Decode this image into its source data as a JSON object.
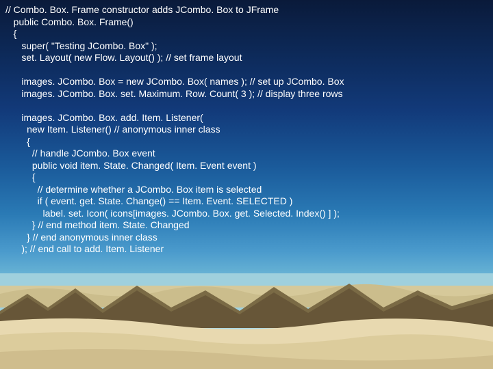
{
  "code": {
    "l01": "// Combo. Box. Frame constructor adds JCombo. Box to JFrame",
    "l02": "   public Combo. Box. Frame()",
    "l03": "   {",
    "l04": "      super( \"Testing JCombo. Box\" );",
    "l05": "      set. Layout( new Flow. Layout() ); // set frame layout",
    "l06": "",
    "l07": "      images. JCombo. Box = new JCombo. Box( names ); // set up JCombo. Box",
    "l08": "      images. JCombo. Box. set. Maximum. Row. Count( 3 ); // display three rows",
    "l09": "",
    "l10": "      images. JCombo. Box. add. Item. Listener(",
    "l11": "        new Item. Listener() // anonymous inner class",
    "l12": "        {",
    "l13": "          // handle JCombo. Box event",
    "l14": "          public void item. State. Changed( Item. Event event )",
    "l15": "          {",
    "l16": "            // determine whether a JCombo. Box item is selected",
    "l17": "            if ( event. get. State. Change() == Item. Event. SELECTED )",
    "l18": "              label. set. Icon( icons[images. JCombo. Box. get. Selected. Index() ] );",
    "l19": "          } // end method item. State. Changed",
    "l20": "        } // end anonymous inner class",
    "l21": "      ); // end call to add. Item. Listener"
  },
  "colors": {
    "sky_top": "#0a1a3a",
    "sky_bottom": "#c0e0e8",
    "sand_light": "#e8d9b0",
    "sand_mid": "#c9b787",
    "sand_dark": "#8a7a4f",
    "rock_dark": "#5a4a30",
    "rock_mid": "#7a6a45",
    "water_reflect": "#7fb8cc",
    "text": "#ffffff"
  }
}
